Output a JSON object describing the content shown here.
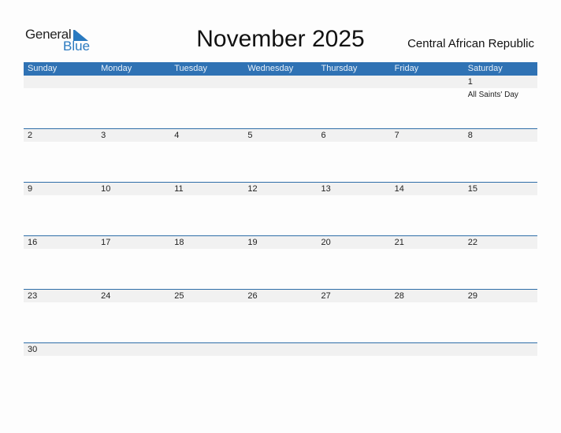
{
  "brand": {
    "word1": "General",
    "word2": "Blue"
  },
  "title": "November 2025",
  "country": "Central African Republic",
  "weekdays": [
    "Sunday",
    "Monday",
    "Tuesday",
    "Wednesday",
    "Thursday",
    "Friday",
    "Saturday"
  ],
  "weeks": [
    [
      {
        "d": ""
      },
      {
        "d": ""
      },
      {
        "d": ""
      },
      {
        "d": ""
      },
      {
        "d": ""
      },
      {
        "d": ""
      },
      {
        "d": "1",
        "holiday": "All Saints' Day"
      }
    ],
    [
      {
        "d": "2"
      },
      {
        "d": "3"
      },
      {
        "d": "4"
      },
      {
        "d": "5"
      },
      {
        "d": "6"
      },
      {
        "d": "7"
      },
      {
        "d": "8"
      }
    ],
    [
      {
        "d": "9"
      },
      {
        "d": "10"
      },
      {
        "d": "11"
      },
      {
        "d": "12"
      },
      {
        "d": "13"
      },
      {
        "d": "14"
      },
      {
        "d": "15"
      }
    ],
    [
      {
        "d": "16"
      },
      {
        "d": "17"
      },
      {
        "d": "18"
      },
      {
        "d": "19"
      },
      {
        "d": "20"
      },
      {
        "d": "21"
      },
      {
        "d": "22"
      }
    ],
    [
      {
        "d": "23"
      },
      {
        "d": "24"
      },
      {
        "d": "25"
      },
      {
        "d": "26"
      },
      {
        "d": "27"
      },
      {
        "d": "28"
      },
      {
        "d": "29"
      }
    ],
    [
      {
        "d": "30"
      },
      {
        "d": ""
      },
      {
        "d": ""
      },
      {
        "d": ""
      },
      {
        "d": ""
      },
      {
        "d": ""
      },
      {
        "d": ""
      }
    ]
  ],
  "colors": {
    "header": "#2f72b4",
    "accent": "#2a7ac0",
    "strip": "#f1f1f1"
  }
}
